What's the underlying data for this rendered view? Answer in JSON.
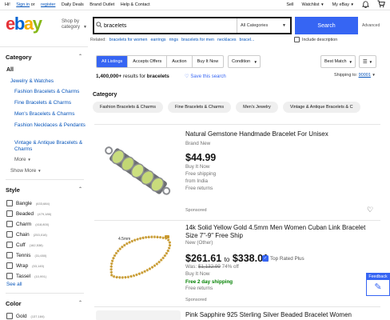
{
  "topbar": {
    "greeting": "Hi!",
    "sign_in": "Sign in",
    "or": "or",
    "register": "register",
    "daily_deals": "Daily Deals",
    "brand_outlet": "Brand Outlet",
    "help_contact": "Help & Contact",
    "sell": "Sell",
    "watchlist": "Watchlist",
    "my_ebay": "My eBay"
  },
  "header": {
    "logo": {
      "e": "e",
      "b": "b",
      "a": "a",
      "y": "y"
    },
    "shop_by_category": "Shop by category",
    "search_value": "bracelets",
    "category_select": "All Categories",
    "search_button": "Search",
    "advanced": "Advanced",
    "related_label": "Related:",
    "related": [
      "bracelets for women",
      "earrings",
      "rings",
      "bracelets for men",
      "necklaces",
      "bracel..."
    ],
    "include_description": "Include description"
  },
  "sidebar": {
    "category_heading": "Category",
    "all": "All",
    "cat_root": "Jewelry & Watches",
    "cat_items": [
      "Fashion Bracelets & Charms",
      "Fine Bracelets & Charms",
      "Men's Bracelets & Charms",
      "Fashion Necklaces & Pendants",
      "Vintage & Antique Bracelets & Charms"
    ],
    "more": "More",
    "show_more": "Show More",
    "style_heading": "Style",
    "style_items": [
      {
        "label": "Bangle",
        "count": "(633,684)"
      },
      {
        "label": "Beaded",
        "count": "(479,186)"
      },
      {
        "label": "Charm",
        "count": "(418,800)"
      },
      {
        "label": "Chain",
        "count": "(253,018)"
      },
      {
        "label": "Cuff",
        "count": "(162,538)"
      },
      {
        "label": "Tennis",
        "count": "(31,650)"
      },
      {
        "label": "Wrap",
        "count": "(53,145)"
      },
      {
        "label": "Tassel",
        "count": "(10,991)"
      }
    ],
    "see_all": "See all",
    "color_heading": "Color",
    "color_items": [
      {
        "label": "Gold",
        "count": "(137,184)"
      }
    ]
  },
  "filters": {
    "tabs": [
      "All Listings",
      "Accepts Offers",
      "Auction",
      "Buy It Now"
    ],
    "condition": "Condition",
    "sort": "Best Match",
    "results_count": "1,400,000+",
    "results_for": "results for",
    "query": "bracelets",
    "save_search": "Save this search",
    "ship_to_label": "Shipping to:",
    "ship_to_zip": "90001",
    "category_title": "Category",
    "pills": [
      "Fashion Bracelets & Charms",
      "Fine Bracelets & Charms",
      "Men's Jewelry",
      "Vintage & Antique Bracelets & C"
    ]
  },
  "items": [
    {
      "title": "Natural Gemstone Handmade Bracelet For Unisex",
      "condition": "Brand New",
      "price": "$44.99",
      "buy_format": "Buy It Now",
      "shipping": "Free shipping",
      "origin": "from India",
      "returns": "Free returns",
      "sponsored": "Sponsored"
    },
    {
      "title": "14k Solid Yellow Gold 4.5mm Men Women Cuban Link Bracelet Size 7\"-9\" Free Ship",
      "condition": "New (Other)",
      "price_low": "$261.61",
      "to": "to",
      "price_high": "$338.01",
      "top_rated": "Top Rated Plus",
      "was_label": "Was:",
      "was_price": "$1,132.99",
      "discount": "74% off",
      "buy_format": "Buy It Now",
      "delivery": "Free 2 day shipping",
      "returns": "Free returns",
      "sponsored": "Sponsored",
      "image_caption": "4.5mm"
    },
    {
      "title": "Pink Sapphire 925 Sterling Silver Beaded Bracelet Women"
    }
  ],
  "feedback": {
    "label": "Feedback"
  },
  "colors": {
    "accent": "#3665f3",
    "link": "#0654ba",
    "green": "#028100"
  }
}
